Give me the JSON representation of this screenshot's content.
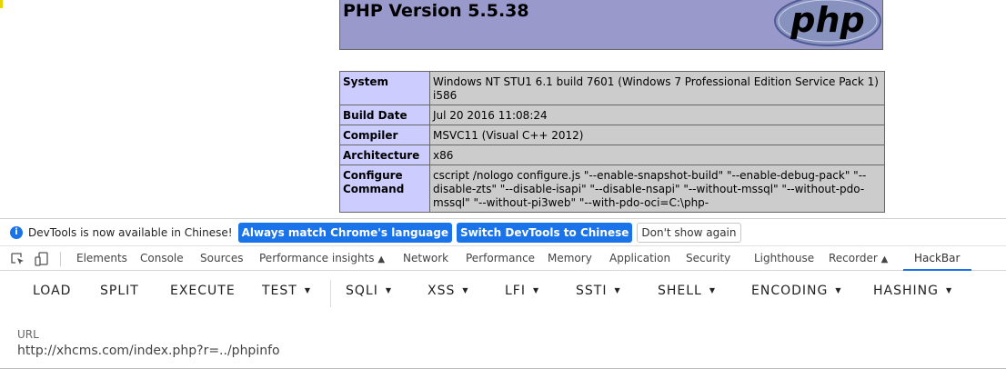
{
  "phpinfo": {
    "title": "PHP Version 5.5.38",
    "logo_text": "php",
    "rows": [
      {
        "key": "System",
        "value": "Windows NT STU1 6.1 build 7601 (Windows 7 Professional Edition Service Pack 1) i586"
      },
      {
        "key": "Build Date",
        "value": "Jul 20 2016 11:08:24"
      },
      {
        "key": "Compiler",
        "value": "MSVC11 (Visual C++ 2012)"
      },
      {
        "key": "Architecture",
        "value": "x86"
      },
      {
        "key": "Configure Command",
        "value": "cscript /nologo configure.js \"--enable-snapshot-build\" \"--enable-debug-pack\" \"--disable-zts\" \"--disable-isapi\" \"--disable-nsapi\" \"--without-mssql\" \"--without-pdo-mssql\" \"--without-pi3web\" \"--with-pdo-oci=C:\\php-"
      }
    ]
  },
  "notice": {
    "message": "DevTools is now available in Chinese!",
    "btn_match": "Always match Chrome's language",
    "btn_switch": "Switch DevTools to Chinese",
    "btn_dismiss": "Don't show again"
  },
  "devtools_tabs": {
    "elements": "Elements",
    "console": "Console",
    "sources": "Sources",
    "performance_insights": "Performance insights",
    "network": "Network",
    "performance": "Performance",
    "memory": "Memory",
    "application": "Application",
    "security": "Security",
    "lighthouse": "Lighthouse",
    "recorder": "Recorder",
    "hackbar": "HackBar"
  },
  "hackbar": {
    "load": "LOAD",
    "split": "SPLIT",
    "execute": "EXECUTE",
    "test": "TEST",
    "sqli": "SQLI",
    "xss": "XSS",
    "lfi": "LFI",
    "ssti": "SSTI",
    "shell": "SHELL",
    "encoding": "ENCODING",
    "hashing": "HASHING"
  },
  "url": {
    "label": "URL",
    "value": "http://xhcms.com/index.php?r=../phpinfo"
  },
  "colors": {
    "php_header_bg": "#9999cc",
    "key_cell_bg": "#ccccff",
    "value_cell_bg": "#cccccc",
    "accent_blue": "#1a73e8"
  }
}
